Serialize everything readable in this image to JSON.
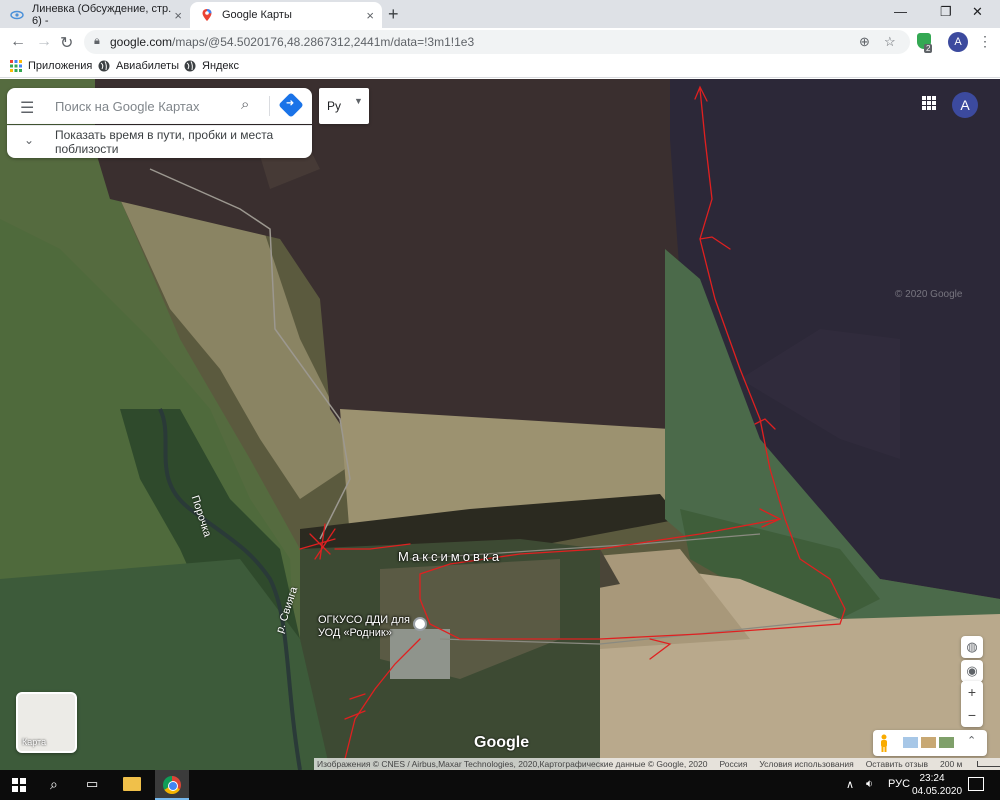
{
  "browser": {
    "tabs": [
      {
        "title": "Линевка (Обсуждение, стр. 6) -",
        "icon": "eye-icon",
        "active": false
      },
      {
        "title": "Google Карты",
        "icon": "maps-pin-icon",
        "active": true
      }
    ],
    "address": {
      "host": "google.com",
      "path": "/maps/@54.5020176,48.2867312,2441m/data=!3m1!1e3"
    },
    "profile_initial": "A",
    "extension_badge": "2",
    "bookmarks": [
      {
        "label": "Приложения",
        "icon": "apps-grid-icon"
      },
      {
        "label": "Авиабилеты",
        "icon": "globe-icon"
      },
      {
        "label": "Яндекс",
        "icon": "globe-icon"
      }
    ]
  },
  "map": {
    "search": {
      "placeholder": "Поиск на Google Картах"
    },
    "traffic_toggle": "Показать время в пути, пробки и места поблизости",
    "language": "Ру",
    "avatar_initial": "A",
    "labels": {
      "village": "Максимовка",
      "place": "ОГКУСО ДДИ для УОД «Родник»",
      "river_1": "Порочка",
      "river_2": "р. Свияга",
      "watermark": "© 2020 Google"
    },
    "layer_switch": "Карта",
    "logo": "Google",
    "attribution": {
      "imagery": "Изображения © CNES / Airbus,Maxar Technologies, 2020,Картографические данные © Google, 2020",
      "country": "Россия",
      "terms": "Условия использования",
      "feedback": "Оставить отзыв",
      "scale": "200 м"
    },
    "zoom": {
      "in": "+",
      "out": "−"
    },
    "colors": {
      "route_annotation": "#e02020",
      "field_dark": "#3a2f2f",
      "field_dark_right": "#2c2838",
      "forest": "#3f5e3a"
    }
  },
  "taskbar": {
    "lang": "РУС",
    "time": "23:24",
    "date": "04.05.2020"
  }
}
